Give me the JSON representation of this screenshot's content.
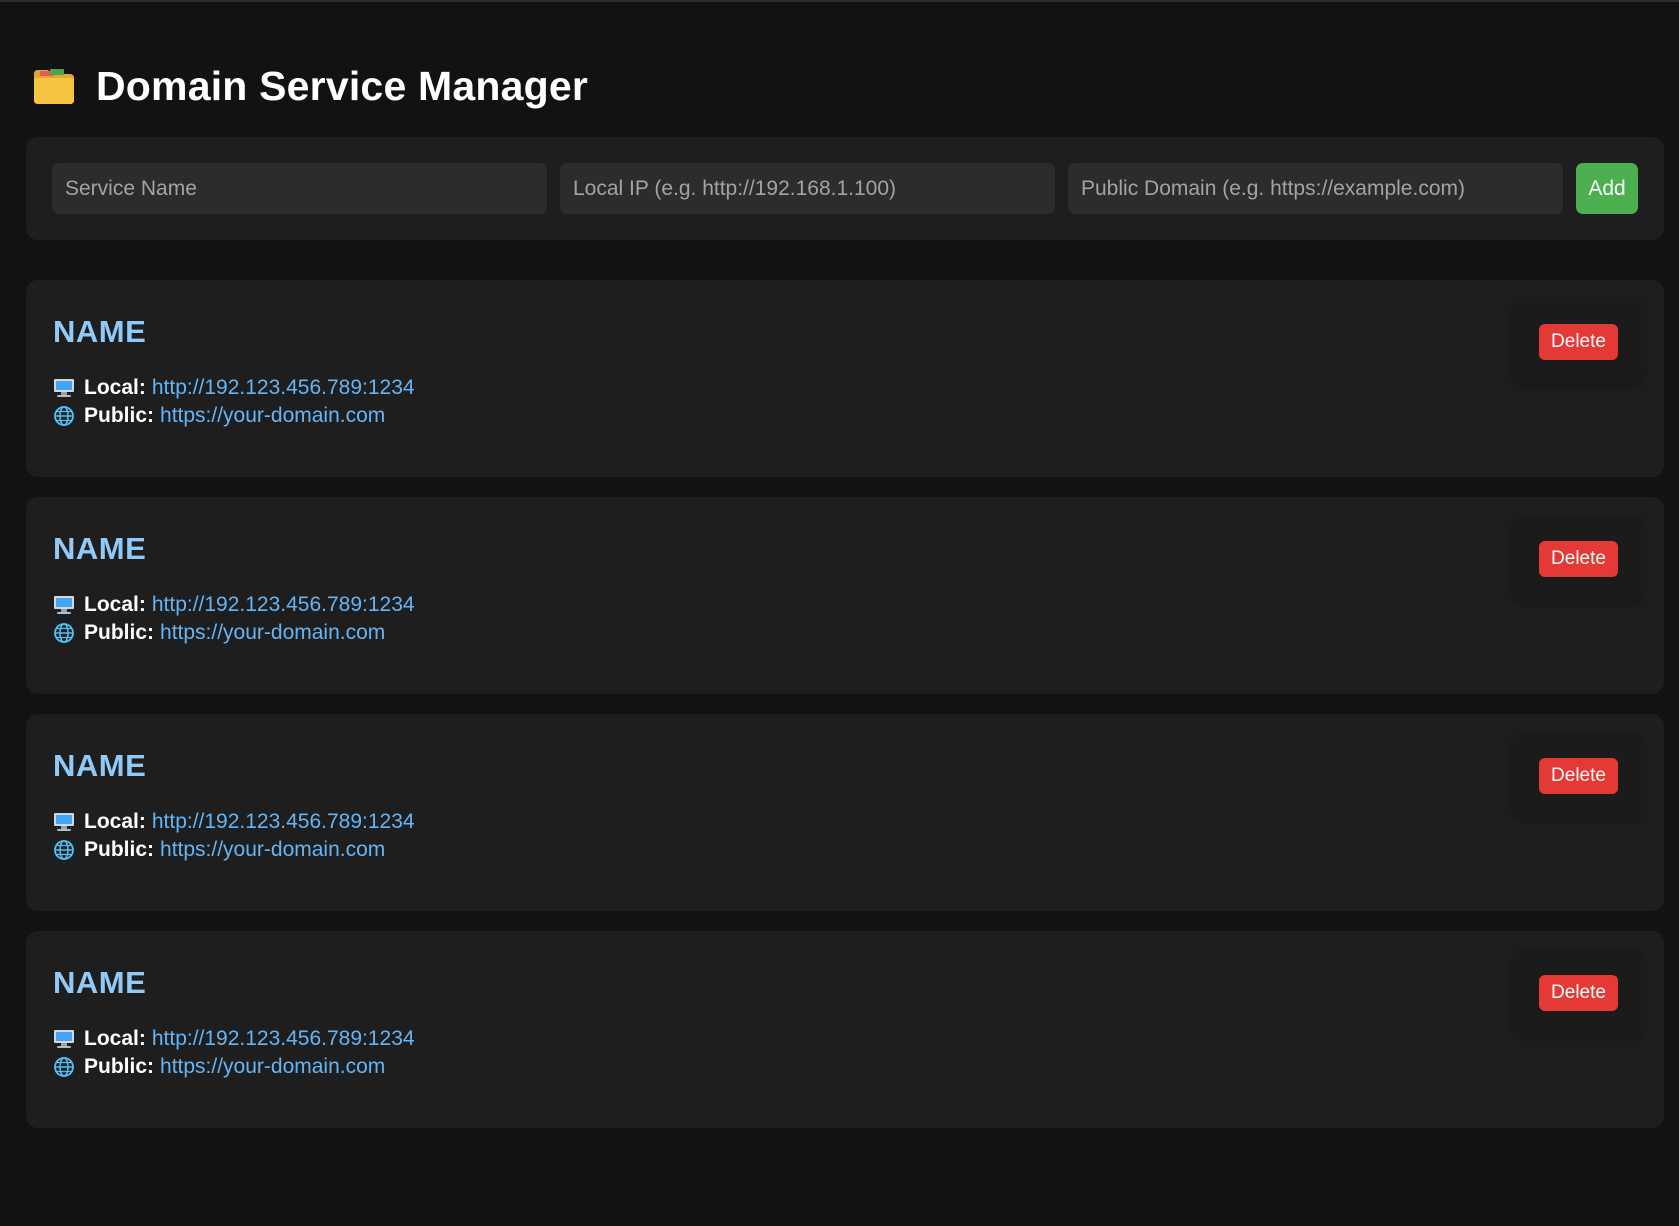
{
  "app": {
    "title": "Domain Service Manager",
    "title_icon": "folder-icon"
  },
  "add_form": {
    "service_name_placeholder": "Service Name",
    "local_ip_placeholder": "Local IP (e.g. http://192.168.1.100)",
    "public_domain_placeholder": "Public Domain (e.g. https://example.com)",
    "add_label": "Add"
  },
  "labels": {
    "local": "Local:",
    "public": "Public:",
    "delete": "Delete"
  },
  "services": [
    {
      "name": "NAME",
      "local": "http://192.123.456.789:1234",
      "public": "https://your-domain.com"
    },
    {
      "name": "NAME",
      "local": "http://192.123.456.789:1234",
      "public": "https://your-domain.com"
    },
    {
      "name": "NAME",
      "local": "http://192.123.456.789:1234",
      "public": "https://your-domain.com"
    },
    {
      "name": "NAME",
      "local": "http://192.123.456.789:1234",
      "public": "https://your-domain.com"
    }
  ],
  "colors": {
    "background": "#121212",
    "panel": "#1e1e1e",
    "accent_name": "#90caf9",
    "link": "#64b5f6",
    "add_button": "#4caf50",
    "delete_button": "#e53935"
  }
}
